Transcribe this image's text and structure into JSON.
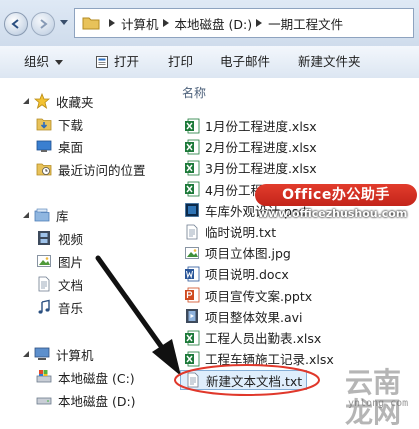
{
  "address": {
    "crumbs": [
      "计算机",
      "本地磁盘 (D:)",
      "一期工程文件"
    ]
  },
  "commands": {
    "organize": "组织",
    "open": "打开",
    "print": "打印",
    "email": "电子邮件",
    "new_folder": "新建文件夹"
  },
  "nav": {
    "favorites": "收藏夹",
    "downloads": "下载",
    "desktop": "桌面",
    "recent": "最近访问的位置",
    "libraries": "库",
    "videos": "视频",
    "pictures": "图片",
    "documents": "文档",
    "music": "音乐",
    "computer": "计算机",
    "drive_c": "本地磁盘 (C:)",
    "drive_d": "本地磁盘 (D:)"
  },
  "files": {
    "header": "名称",
    "items": [
      {
        "name": "1月份工程进度.xlsx",
        "icon": "excel-icon"
      },
      {
        "name": "2月份工程进度.xlsx",
        "icon": "excel-icon"
      },
      {
        "name": "3月份工程进度.xlsx",
        "icon": "excel-icon"
      },
      {
        "name": "4月份工程进度.xlsx",
        "icon": "excel-icon"
      },
      {
        "name": "车库外观设计.psd",
        "icon": "psd-icon"
      },
      {
        "name": "临时说明.txt",
        "icon": "text-icon"
      },
      {
        "name": "项目立体图.jpg",
        "icon": "image-icon"
      },
      {
        "name": "项目说明.docx",
        "icon": "word-icon"
      },
      {
        "name": "项目宣传文案.pptx",
        "icon": "powerpoint-icon"
      },
      {
        "name": "项目整体效果.avi",
        "icon": "video-icon"
      },
      {
        "name": "工程人员出勤表.xlsx",
        "icon": "excel-icon"
      },
      {
        "name": "工程车辆施工记录.xlsx",
        "icon": "excel-icon"
      },
      {
        "name": "新建文本文档.txt",
        "icon": "text-icon"
      }
    ]
  },
  "watermarks": {
    "badge": "Office办公助手",
    "url": "www.officezhushou.com",
    "logo_cn": "云南龙网",
    "logo_domain": "ynlong.com"
  },
  "colors": {
    "excel": "#1d7a3a",
    "word": "#2a5699",
    "powerpoint": "#d04a1f",
    "annotation_red": "#e0382b"
  }
}
